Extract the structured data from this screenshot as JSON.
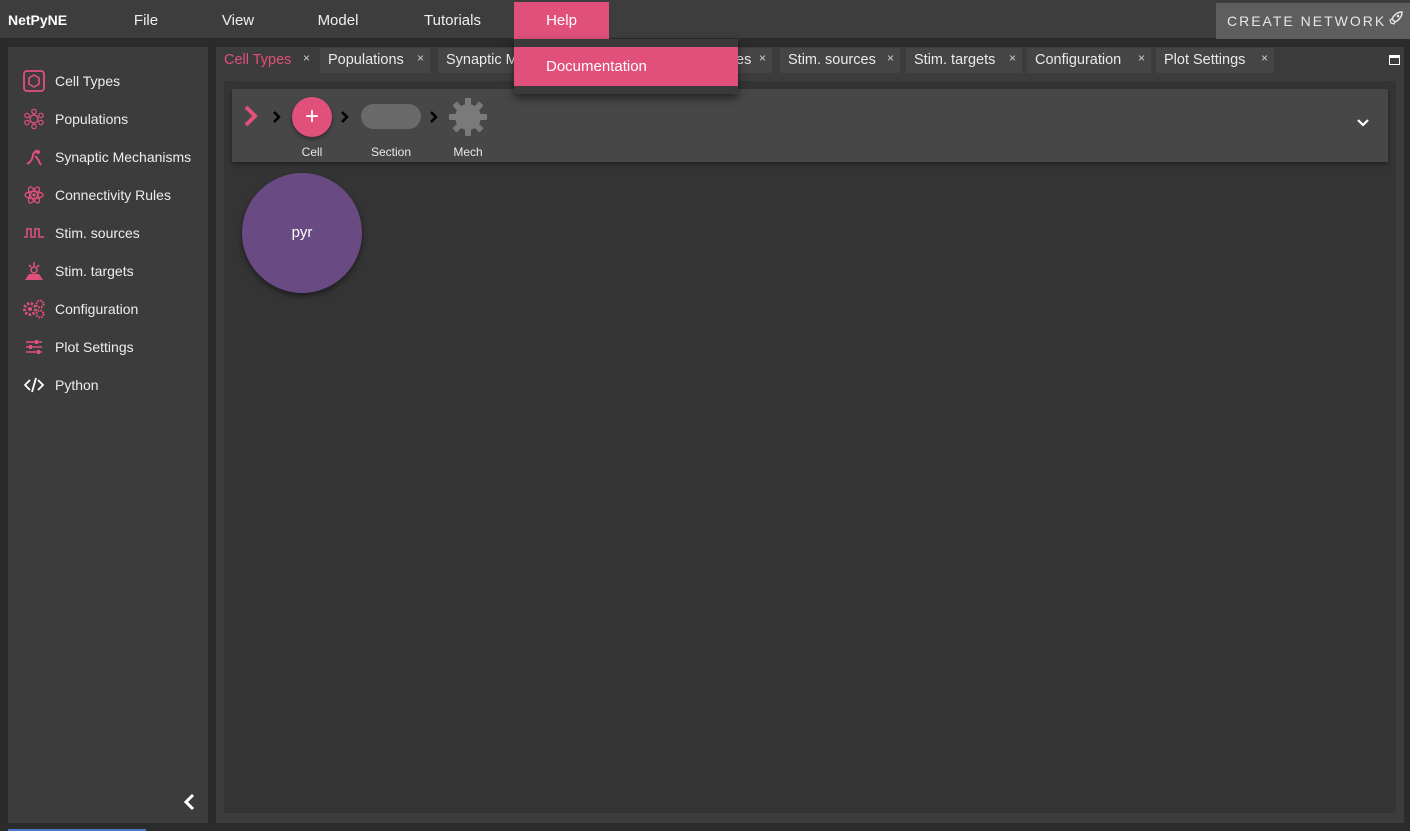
{
  "brand": "NetPyNE",
  "menu": [
    {
      "label": "File"
    },
    {
      "label": "View"
    },
    {
      "label": "Model"
    },
    {
      "label": "Tutorials"
    },
    {
      "label": "Help"
    }
  ],
  "create_network": {
    "label": "CREATE NETWORK",
    "icon": "rocket-icon"
  },
  "help_menu": {
    "items": [
      {
        "label": "Documentation"
      }
    ]
  },
  "sidebar": {
    "items": [
      {
        "label": "Cell Types",
        "icon": "hexagon-icon"
      },
      {
        "label": "Populations",
        "icon": "cells-icon"
      },
      {
        "label": "Synaptic Mechanisms",
        "icon": "synapse-icon"
      },
      {
        "label": "Connectivity Rules",
        "icon": "atom-icon"
      },
      {
        "label": "Stim. sources",
        "icon": "pulse-icon"
      },
      {
        "label": "Stim. targets",
        "icon": "target-icon"
      },
      {
        "label": "Configuration",
        "icon": "gears-icon"
      },
      {
        "label": "Plot Settings",
        "icon": "sliders-icon"
      },
      {
        "label": "Python",
        "icon": "code-icon"
      }
    ]
  },
  "tabs": [
    {
      "label": "Cell Types"
    },
    {
      "label": "Populations"
    },
    {
      "label": "Synaptic M"
    },
    {
      "label": "es"
    },
    {
      "label": "Stim. sources"
    },
    {
      "label": "Stim. targets"
    },
    {
      "label": "Configuration"
    },
    {
      "label": "Plot Settings"
    }
  ],
  "breadcrumb": {
    "cell_label": "Cell",
    "section_label": "Section",
    "mech_label": "Mech"
  },
  "cells": [
    {
      "name": "pyr"
    }
  ],
  "colors": {
    "accent": "#e0507a",
    "cell": "#6a4a82"
  }
}
